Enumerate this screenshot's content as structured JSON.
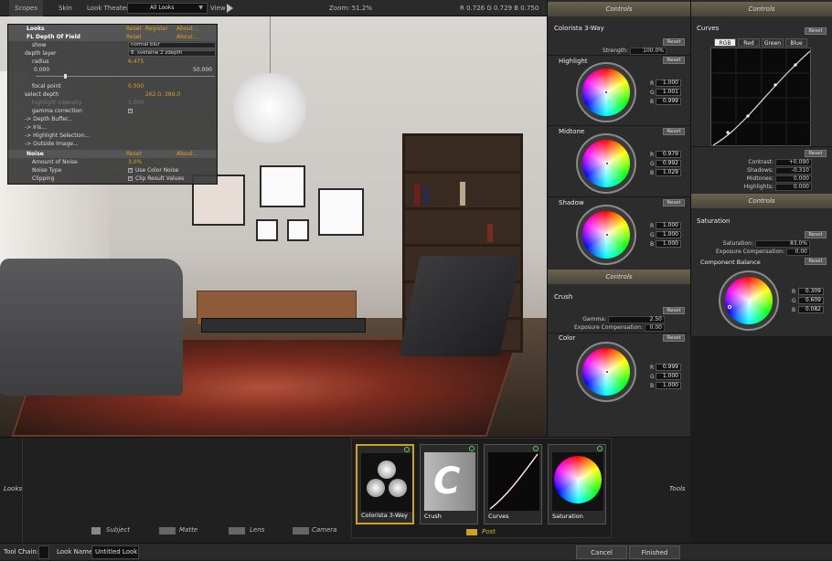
{
  "topbar": {
    "tabs": [
      "Scopes",
      "Skin"
    ],
    "look_theater_label": "Look Theater",
    "look_select_value": "All Looks",
    "view_label": "View",
    "zoom": "Zoom:  51.2%",
    "readout": "R 0.726   G 0.729   B 0.750"
  },
  "fx_panel": {
    "looks_header": "Looks",
    "looks_reset": "Reset",
    "looks_register": "Register",
    "looks_about": "About...",
    "dof_header": "FL Depth Of Field",
    "dof_reset": "Reset",
    "dof_about": "About...",
    "show_label": "show",
    "show_value": "normal blur",
    "depth_layer_label": "depth layer",
    "depth_layer_value": "8. svetaine 2 zdepth",
    "radius_label": "radius",
    "radius_value": "6.475",
    "radius_min": "0.000",
    "radius_max": "50.000",
    "focal_point_label": "focal point",
    "focal_point_value": "0.000",
    "select_depth_label": "select depth",
    "select_depth_value": "262.0, 389.0",
    "highlight_intensity_label": "highlight intensity",
    "highlight_intensity_value": "1.000",
    "gamma_correction_label": "gamma correction",
    "depth_buffer": "-> Depth Buffer...",
    "iris": "-> Iris...",
    "highlight_selection": "-> Highlight Selection...",
    "outside_image": "-> Outside Image...",
    "noise_header": "Noise",
    "noise_reset": "Reset",
    "noise_about": "About...",
    "amount_label": "Amount of Noise",
    "amount_value": "3.0%",
    "noise_type_label": "Noise Type",
    "noise_type_value": "Use Color Noise",
    "clipping_label": "Clipping",
    "clipping_value": "Clip Result Values"
  },
  "controls": {
    "header": "Controls",
    "colorista_title": "Colorista 3-Way",
    "reset": "Reset",
    "strength_label": "Strength:",
    "strength_value": "100.0%",
    "highlight": {
      "title": "Highlight",
      "r": "1.000",
      "g": "1.001",
      "b": "0.999"
    },
    "midtone": {
      "title": "Midtone",
      "r": "0.979",
      "g": "0.992",
      "b": "1.029"
    },
    "shadow": {
      "title": "Shadow",
      "r": "1.000",
      "g": "1.000",
      "b": "1.000"
    },
    "header2": "Controls",
    "crush_title": "Crush",
    "gamma_label": "Gamma:",
    "gamma_value": "2.50",
    "exposure_label": "Exposure Compensation:",
    "exposure_value": "0.00",
    "color": {
      "title": "Color",
      "r": "0.999",
      "g": "1.000",
      "b": "1.000"
    }
  },
  "right_panel": {
    "header": "Controls",
    "curves_title": "Curves",
    "reset": "Reset",
    "tabs": [
      "RGB",
      "Red",
      "Green",
      "Blue"
    ],
    "contrast_label": "Contrast:",
    "contrast_value": "+0.090",
    "shadows_label": "Shadows:",
    "shadows_value": "-0.310",
    "midtones_label": "Midtones:",
    "midtones_value": "0.000",
    "highlights_label": "Highlights:",
    "highlights_value": "0.000",
    "header2": "Controls",
    "saturation_title": "Saturation",
    "saturation_label": "Saturation:",
    "saturation_value": "83.0%",
    "exposure_label": "Exposure Compensation:",
    "exposure_value": "0.00",
    "component_balance": "Component Balance",
    "cb": {
      "r": "0.309",
      "g": "0.609",
      "b": "0.082"
    }
  },
  "bottom": {
    "looks_label": "Looks",
    "tools_label": "Tools",
    "categories": [
      "Subject",
      "Matte",
      "Lens",
      "Camera",
      "Post"
    ],
    "tools": [
      "Colorista 3-Way",
      "Crush",
      "Curves",
      "Saturation"
    ]
  },
  "statusbar": {
    "tool_chain": "Tool Chain:",
    "look_name_label": "Look Name:",
    "look_name_value": "Untitled Look",
    "cancel": "Cancel",
    "finished": "Finished"
  }
}
